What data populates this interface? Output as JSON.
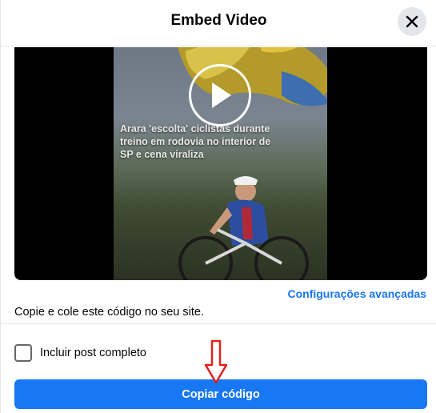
{
  "dialog": {
    "title": "Embed Video",
    "close_icon": "close-icon"
  },
  "video": {
    "caption": "Arara 'escolta' ciclistas durante treino em rodovia no interior de SP e cena viraliza",
    "play_icon": "play-icon"
  },
  "options": {
    "advanced_link": "Configurações avançadas",
    "instructions": "Copie e cole este código no seu site.",
    "include_post_label": "Incluir post completo",
    "include_post_checked": false
  },
  "actions": {
    "copy_label": "Copiar código"
  },
  "colors": {
    "accent": "#1877f2",
    "annotation_arrow": "#e02020"
  }
}
